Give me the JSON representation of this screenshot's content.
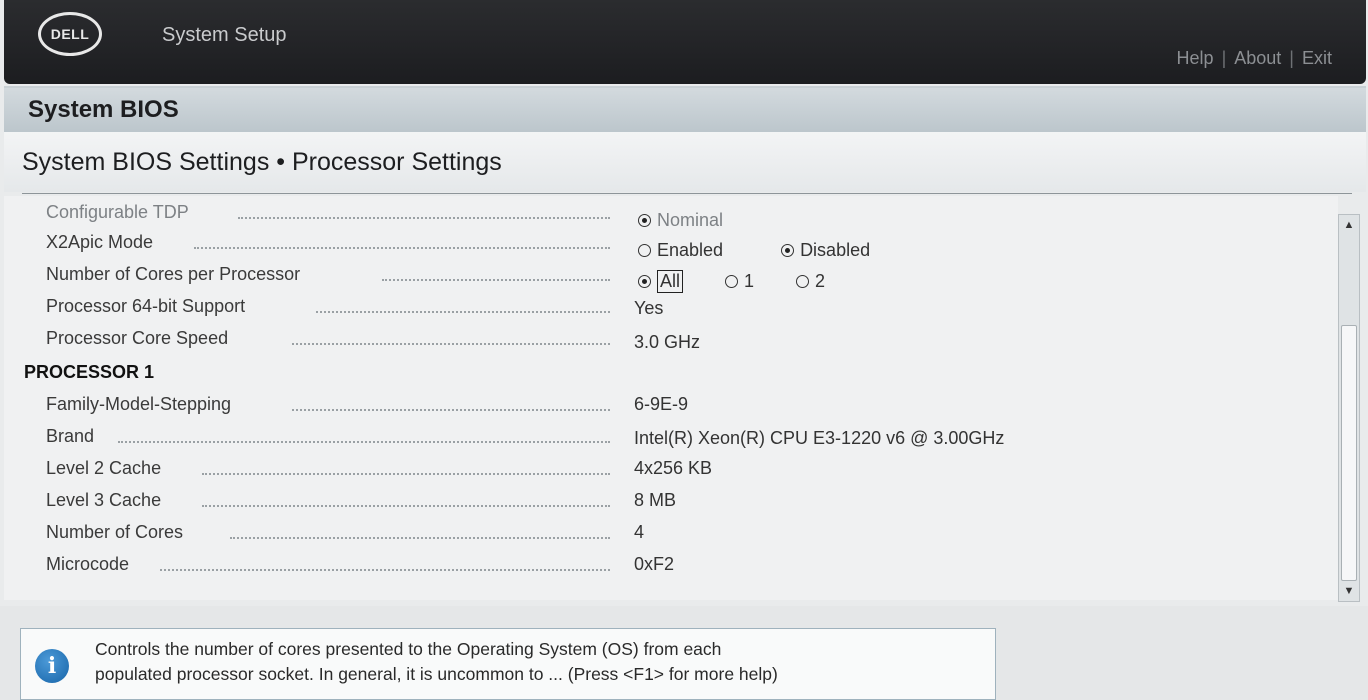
{
  "header": {
    "logo_text": "DELL",
    "app_title": "System Setup",
    "links": [
      "Help",
      "About",
      "Exit"
    ]
  },
  "section": {
    "title": "System BIOS",
    "breadcrumb": "System BIOS Settings • Processor Settings"
  },
  "settings": [
    {
      "label": "Configurable TDP",
      "type": "radio",
      "options": [
        "Nominal"
      ],
      "selected": "Nominal",
      "disabled": true
    },
    {
      "label": "X2Apic Mode",
      "type": "radio",
      "options": [
        "Enabled",
        "Disabled"
      ],
      "selected": "Disabled"
    },
    {
      "label": "Number of Cores per Processor",
      "type": "radio",
      "options": [
        "All",
        "1",
        "2"
      ],
      "selected": "All",
      "focused": "All"
    },
    {
      "label": "Processor 64-bit Support",
      "type": "text",
      "value": "Yes"
    },
    {
      "label": "Processor Core Speed",
      "type": "text",
      "value": "3.0 GHz"
    }
  ],
  "processor_heading": "PROCESSOR 1",
  "processor_info": [
    {
      "label": "Family-Model-Stepping",
      "value": "6-9E-9"
    },
    {
      "label": "Brand",
      "value": "Intel(R) Xeon(R) CPU E3-1220 v6 @ 3.00GHz"
    },
    {
      "label": "Level 2 Cache",
      "value": "4x256 KB"
    },
    {
      "label": "Level 3 Cache",
      "value": "8 MB"
    },
    {
      "label": "Number of Cores",
      "value": "4"
    },
    {
      "label": "Microcode",
      "value": "0xF2"
    }
  ],
  "help": {
    "icon": "info-icon",
    "line1": "Controls the number of cores presented to the Operating System (OS) from each",
    "line2": "populated processor socket. In general, it is uncommon to ... (Press <F1> for more help)"
  },
  "colors": {
    "header_bg": "#1c1d20",
    "section_bg": "#bcc6cc",
    "content_bg": "#f0f1f2",
    "info_blue": "#1764a8"
  }
}
